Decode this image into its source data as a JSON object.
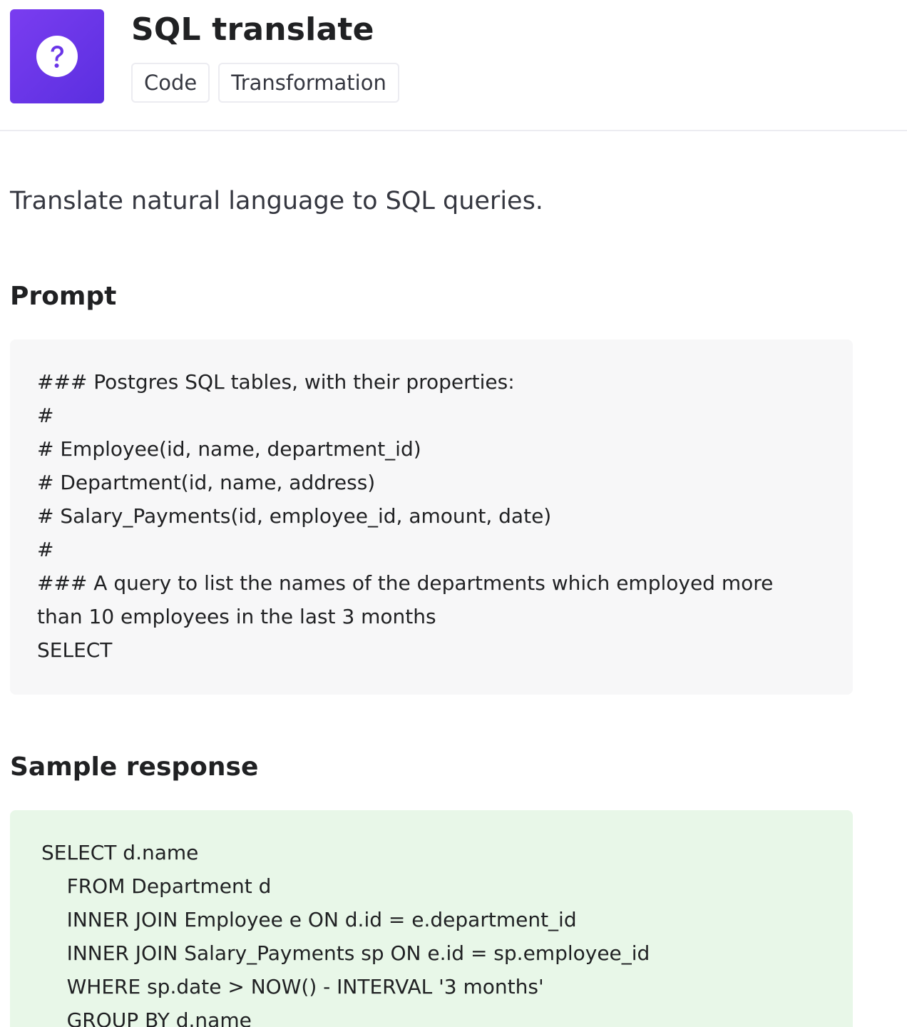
{
  "header": {
    "icon": "question-mark-icon",
    "title": "SQL translate",
    "tags": [
      "Code",
      "Transformation"
    ]
  },
  "description": "Translate natural language to SQL queries.",
  "prompt": {
    "heading": "Prompt",
    "lines": [
      "### Postgres SQL tables, with their properties:",
      "#",
      "# Employee(id, name, department_id)",
      "# Department(id, name, address)",
      "# Salary_Payments(id, employee_id, amount, date)",
      "#",
      "### A query to list the names of the departments which employed more",
      "than 10 employees in the last 3 months",
      "SELECT"
    ]
  },
  "response": {
    "heading": "Sample response",
    "lines": [
      "SELECT d.name",
      "    FROM Department d",
      "    INNER JOIN Employee e ON d.id = e.department_id",
      "    INNER JOIN Salary_Payments sp ON e.id = sp.employee_id",
      "    WHERE sp.date > NOW() - INTERVAL '3 months'",
      "    GROUP BY d.name"
    ]
  },
  "colors": {
    "icon_bg": "#6a35e8",
    "prompt_bg": "#f7f7f8",
    "response_bg": "#e8f7e8"
  }
}
